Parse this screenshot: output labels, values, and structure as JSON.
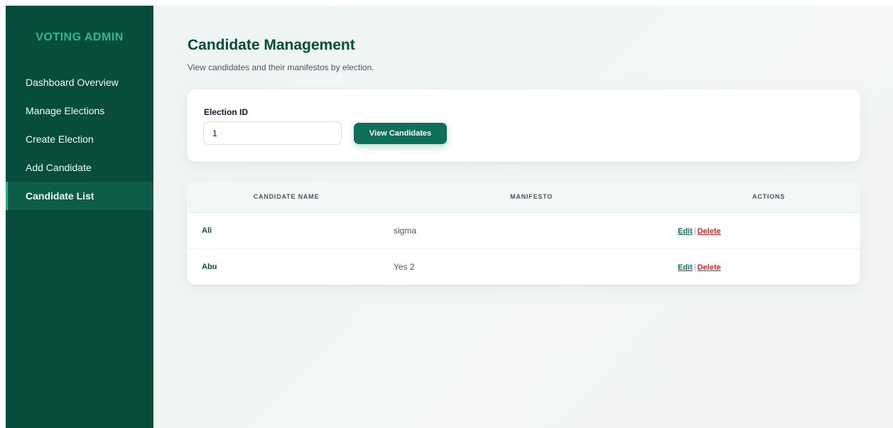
{
  "sidebar": {
    "brand": "VOTING ADMIN",
    "items": [
      {
        "label": "Dashboard Overview",
        "active": false
      },
      {
        "label": "Manage Elections",
        "active": false
      },
      {
        "label": "Create Election",
        "active": false
      },
      {
        "label": "Add Candidate",
        "active": false
      },
      {
        "label": "Candidate List",
        "active": true
      }
    ]
  },
  "header": {
    "title": "Candidate Management",
    "subtitle": "View candidates and their manifestos by election."
  },
  "filter": {
    "label": "Election ID",
    "value": "1",
    "button_label": "View Candidates"
  },
  "table": {
    "columns": [
      "CANDIDATE NAME",
      "MANIFESTO",
      "ACTIONS"
    ],
    "rows": [
      {
        "name": "Ali",
        "manifesto": "sigma",
        "edit": "Edit",
        "separator": "|",
        "delete": "Delete"
      },
      {
        "name": "Abu",
        "manifesto": "Yes 2",
        "edit": "Edit",
        "separator": "|",
        "delete": "Delete"
      }
    ]
  },
  "colors": {
    "sidebar_bg": "#064e3b",
    "brand_accent": "#34b68a",
    "primary_button": "#0e6f5c",
    "delete": "#dc2626"
  }
}
